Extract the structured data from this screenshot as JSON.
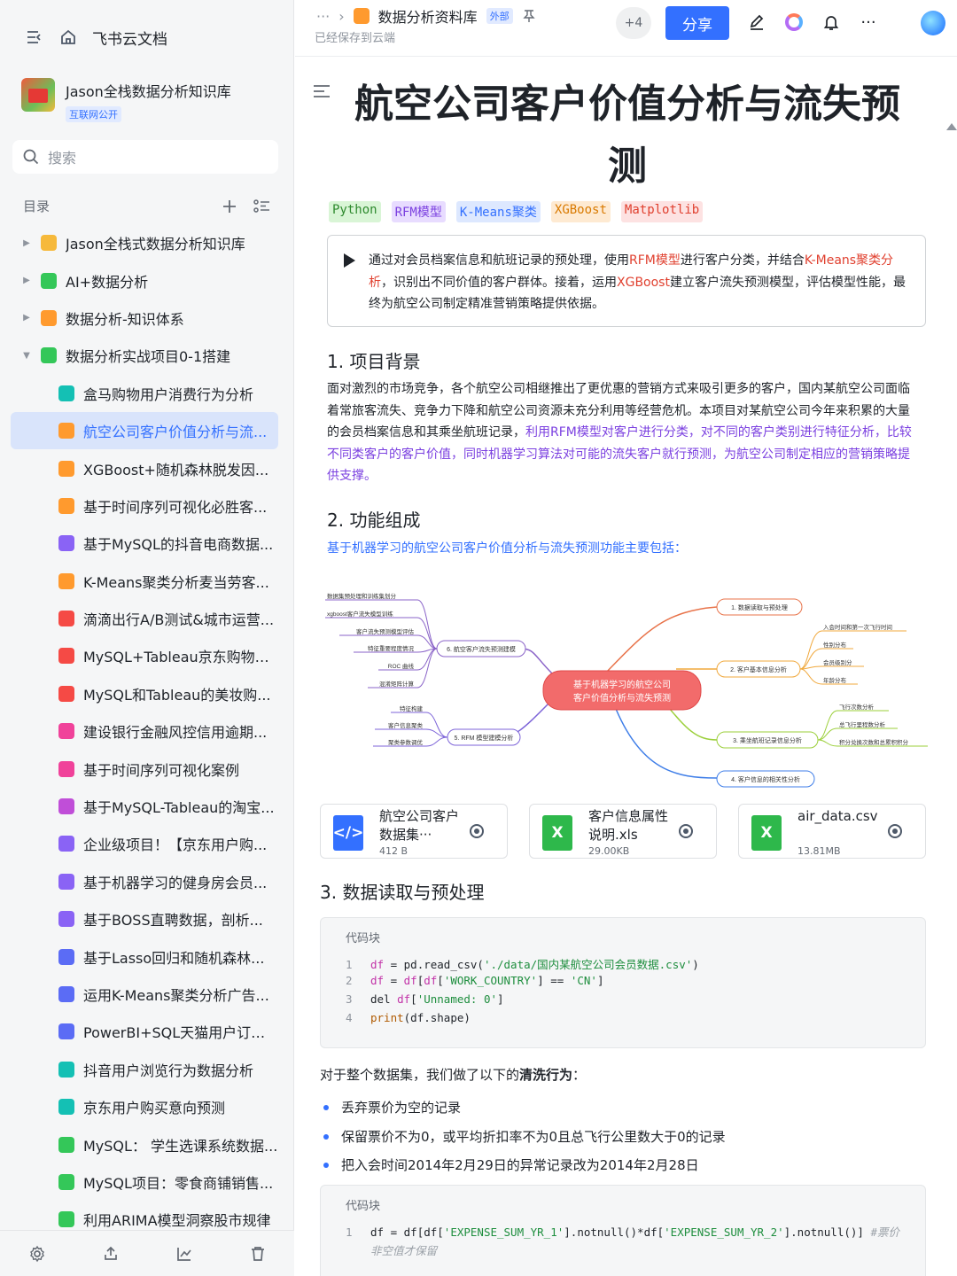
{
  "sidebar": {
    "app_title": "飞书云文档",
    "kb_name": "Jason全栈数据分析知识库",
    "kb_badge": "互联网公开",
    "search_placeholder": "搜索",
    "toc_label": "目录",
    "items": [
      {
        "label": "Jason全栈式数据分析知识库",
        "color": "#f6b93b"
      },
      {
        "label": "AI+数据分析",
        "color": "#34c759"
      },
      {
        "label": "数据分析-知识体系",
        "color": "#ff9a2e"
      },
      {
        "label": "数据分析实战项目0-1搭建",
        "color": "#34c759"
      }
    ],
    "children": [
      {
        "label": "盒马购物用户消费行为分析",
        "color": "#14c0b4"
      },
      {
        "label": "航空公司客户价值分析与流...",
        "color": "#ff9a2e"
      },
      {
        "label": "XGBoost+随机森林脱发因...",
        "color": "#ff9a2e"
      },
      {
        "label": "基于时间序列可视化必胜客...",
        "color": "#ff9a2e"
      },
      {
        "label": "基于MySQL的抖音电商数据...",
        "color": "#8a63f5"
      },
      {
        "label": "K-Means聚类分析麦当劳客...",
        "color": "#ff9a2e"
      },
      {
        "label": "滴滴出行A/B测试&城市运营...",
        "color": "#f54a45"
      },
      {
        "label": "MySQL+Tableau京东购物分...",
        "color": "#f54a45"
      },
      {
        "label": "MySQL和Tableau的美妆购...",
        "color": "#f54a45"
      },
      {
        "label": "建设银行金融风控信用逾期...",
        "color": "#f0429a"
      },
      {
        "label": "基于时间序列可视化案例",
        "color": "#f0429a"
      },
      {
        "label": "基于MySQL-Tableau的淘宝...",
        "color": "#c04ed8"
      },
      {
        "label": "企业级项目！【京东用户购...",
        "color": "#8a63f5"
      },
      {
        "label": "基于机器学习的健身房会员...",
        "color": "#8a63f5"
      },
      {
        "label": "基于BOSS直聘数据，剖析...",
        "color": "#8a63f5"
      },
      {
        "label": "基于Lasso回归和随机森林...",
        "color": "#5b6cf5"
      },
      {
        "label": "运用K-Means聚类分析广告...",
        "color": "#5b6cf5"
      },
      {
        "label": "PowerBI+SQL天猫用户订单...",
        "color": "#5b6cf5"
      },
      {
        "label": "抖音用户浏览行为数据分析",
        "color": "#14c0b4"
      },
      {
        "label": "京东用户购买意向预测",
        "color": "#14c0b4"
      },
      {
        "label": "MySQL： 学生选课系统数据...",
        "color": "#34c759"
      },
      {
        "label": "MySQL项目：零食商铺销售...",
        "color": "#34c759"
      },
      {
        "label": "利用ARIMA模型洞察股市规律",
        "color": "#34c759"
      }
    ]
  },
  "topbar": {
    "more": "···",
    "doc_title": "数据分析资料库",
    "ext_badge": "外部",
    "saved": "已经保存到云端",
    "collaborators": "+4",
    "share": "分享"
  },
  "doc": {
    "title": "航空公司客户价值分析与流失预测",
    "tags": [
      {
        "label": "Python",
        "fg": "#2e8a2e",
        "bg": "#d9f5d6"
      },
      {
        "label": "RFM模型",
        "fg": "#7b40e0",
        "bg": "#e8dcff"
      },
      {
        "label": "K-Means聚类",
        "fg": "#3370ff",
        "bg": "#dde8ff"
      },
      {
        "label": "XGBoost",
        "fg": "#d97a00",
        "bg": "#feead2"
      },
      {
        "label": "Matplotlib",
        "fg": "#e0402f",
        "bg": "#fde2e2"
      }
    ],
    "callout": {
      "t1": "通过对会员档案信息和航班记录的预处理，使用",
      "t2": "RFM模型",
      "t3": "进行客户分类，并结合",
      "t4": "K-Means聚类分析",
      "t5": "，识别出不同价值的客户群体。接着，运用",
      "t6": "XGBoost",
      "t7": "建立客户流失预测模型，评估模型性能，最终为航空公司制定精准营销策略提供依据。"
    },
    "sec1": "1. 项目背景",
    "sec1_p1": "面对激烈的市场竞争，各个航空公司相继推出了更优惠的营销方式来吸引更多的客户，国内某航空公司面临着常旅客流失、竞争力下降和航空公司资源未充分利用等经营危机。本项目对某航空公司今年来积累的大量的会员档案信息和其乘坐航班记录，",
    "sec1_p2": "利用RFM模型对客户进行分类，对不同的客户类别进行特征分析，比较不同类客户的客户价值，同时机器学习算法对可能的流失客户就行预测，为航空公司制定相应的营销策略提供支撑。",
    "sec2": "2. 功能组成",
    "sec2_lead": "基于机器学习的航空公司客户价值分析与流失预测功能主要包括：",
    "mindmap": {
      "center_l1": "基于机器学习的航空公司",
      "center_l2": "客户价值分析与流失预测",
      "b1": "1. 数据读取与预处理",
      "b2": "2. 客户基本信息分析",
      "b2_leaves": [
        "入会时间和第一次飞行时间",
        "性别分布",
        "会员级别分",
        "年龄分布"
      ],
      "b3": "3. 乘坐航班记录信息分析",
      "b3_leaves": [
        "飞行次数分析",
        "总飞行里程数分析",
        "积分兑换次数和总累积积分"
      ],
      "b4": "4. 客户信息的相关性分析",
      "b5": "5. RFM 模型建模分析",
      "b5_leaves": [
        "特征构建",
        "客户信息聚类",
        "聚类参数调优"
      ],
      "b6": "6. 航空客户流失预测建模",
      "b6_leaves": [
        "数据集预处理和训练集划分",
        "xgboost客户流失模型训练",
        "客户流失预测模型评估",
        "特征重要程度情况",
        "ROC 曲线",
        "混淆矩阵计算"
      ]
    },
    "files": [
      {
        "name": "航空公司客户数据集···",
        "size": "412 B",
        "icon": "</>",
        "color": "#3370ff"
      },
      {
        "name": "客户信息属性说明.xls",
        "size": "29.00KB",
        "icon": "X",
        "color": "#2eb84b"
      },
      {
        "name": "air_data.csv",
        "size": "13.81MB",
        "icon": "X",
        "color": "#2eb84b"
      }
    ],
    "sec3": "3. 数据读取与预处理",
    "code_label": "代码块",
    "code1": {
      "l1_a": "df",
      "l1_b": " = pd.read_csv(",
      "l1_c": "'./data/国内某航空公司会员数据.csv'",
      "l1_d": ")",
      "l2_a": "df",
      "l2_b": " = ",
      "l2_c": "df",
      "l2_d": "[",
      "l2_e": "df",
      "l2_f": "[",
      "l2_g": "'WORK_COUNTRY'",
      "l2_h": "] == ",
      "l2_i": "'CN'",
      "l2_j": "]",
      "l3_a": "del ",
      "l3_b": "df",
      "l3_c": "[",
      "l3_d": "'Unnamed: 0'",
      "l3_e": "]",
      "l4_a": "print",
      "l4_b": "(df.shape)"
    },
    "clean_a": "对于整个数据集，我们做了以下的",
    "clean_b": "清洗行为",
    "clean_c": "：",
    "bullets": [
      "丢弃票价为空的记录",
      "保留票价不为0，或平均折扣率不为0且总飞行公里数大于0的记录",
      "把入会时间2014年2月29日的异常记录改为2014年2月28日"
    ],
    "code2": {
      "a": "df",
      "b": " = df[df[",
      "c": "'EXPENSE_SUM_YR_1'",
      "d": "].notnull()*df[",
      "e": "'EXPENSE_SUM_YR_2'",
      "f": "].notnull()]",
      "comment1": "#票价",
      "comment2": "非空值才保留"
    }
  }
}
